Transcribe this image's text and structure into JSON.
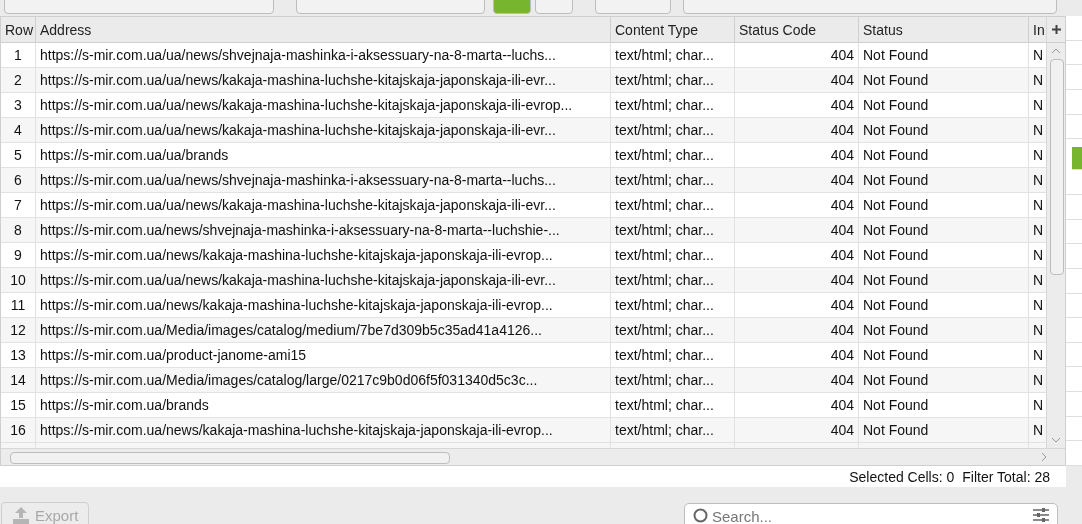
{
  "table": {
    "columns": [
      "Row",
      "Address",
      "Content Type",
      "Status Code",
      "Status",
      "In"
    ],
    "rows": [
      [
        "1",
        "https://s-mir.com.ua/ua/news/shvejnaja-mashinka-i-aksessuary-na-8-marta--luchs...",
        "text/html; char...",
        "404",
        "Not Found",
        "N"
      ],
      [
        "2",
        "https://s-mir.com.ua/ua/news/kakaja-mashina-luchshe-kitajskaja-japonskaja-ili-evr...",
        "text/html; char...",
        "404",
        "Not Found",
        "N"
      ],
      [
        "3",
        "https://s-mir.com.ua/ua/news/kakaja-mashina-luchshe-kitajskaja-japonskaja-ili-evrop...",
        "text/html; char...",
        "404",
        "Not Found",
        "N"
      ],
      [
        "4",
        "https://s-mir.com.ua/ua/news/kakaja-mashina-luchshe-kitajskaja-japonskaja-ili-evr...",
        "text/html; char...",
        "404",
        "Not Found",
        "N"
      ],
      [
        "5",
        "https://s-mir.com.ua/ua/brands",
        "text/html; char...",
        "404",
        "Not Found",
        "N"
      ],
      [
        "6",
        "https://s-mir.com.ua/ua/news/shvejnaja-mashinka-i-aksessuary-na-8-marta--luchs...",
        "text/html; char...",
        "404",
        "Not Found",
        "N"
      ],
      [
        "7",
        "https://s-mir.com.ua/ua/news/kakaja-mashina-luchshe-kitajskaja-japonskaja-ili-evr...",
        "text/html; char...",
        "404",
        "Not Found",
        "N"
      ],
      [
        "8",
        "https://s-mir.com.ua/news/shvejnaja-mashinka-i-aksessuary-na-8-marta--luchshie-...",
        "text/html; char...",
        "404",
        "Not Found",
        "N"
      ],
      [
        "9",
        "https://s-mir.com.ua/news/kakaja-mashina-luchshe-kitajskaja-japonskaja-ili-evrop...",
        "text/html; char...",
        "404",
        "Not Found",
        "N"
      ],
      [
        "10",
        "https://s-mir.com.ua/ua/news/kakaja-mashina-luchshe-kitajskaja-japonskaja-ili-evr...",
        "text/html; char...",
        "404",
        "Not Found",
        "N"
      ],
      [
        "11",
        "https://s-mir.com.ua/news/kakaja-mashina-luchshe-kitajskaja-japonskaja-ili-evrop...",
        "text/html; char...",
        "404",
        "Not Found",
        "N"
      ],
      [
        "12",
        "https://s-mir.com.ua/Media/images/catalog/medium/7be7d309b5c35ad41a4126...",
        "text/html; char...",
        "404",
        "Not Found",
        "N"
      ],
      [
        "13",
        "https://s-mir.com.ua/product-janome-ami15",
        "text/html; char...",
        "404",
        "Not Found",
        "N"
      ],
      [
        "14",
        "https://s-mir.com.ua/Media/images/catalog/large/0217c9b0d06f5f031340d5c3c...",
        "text/html; char...",
        "404",
        "Not Found",
        "N"
      ],
      [
        "15",
        "https://s-mir.com.ua/brands",
        "text/html; char...",
        "404",
        "Not Found",
        "N"
      ],
      [
        "16",
        "https://s-mir.com.ua/news/kakaja-mashina-luchshe-kitajskaja-japonskaja-ili-evrop...",
        "text/html; char...",
        "404",
        "Not Found",
        "N"
      ]
    ]
  },
  "status_bar": [
    {
      "label": "Selected Cells:",
      "value": "0"
    },
    {
      "label": "Filter Total:",
      "value": "28"
    }
  ],
  "bottom": {
    "export_button": "Export",
    "search": {
      "placeholder": "Search..."
    }
  }
}
